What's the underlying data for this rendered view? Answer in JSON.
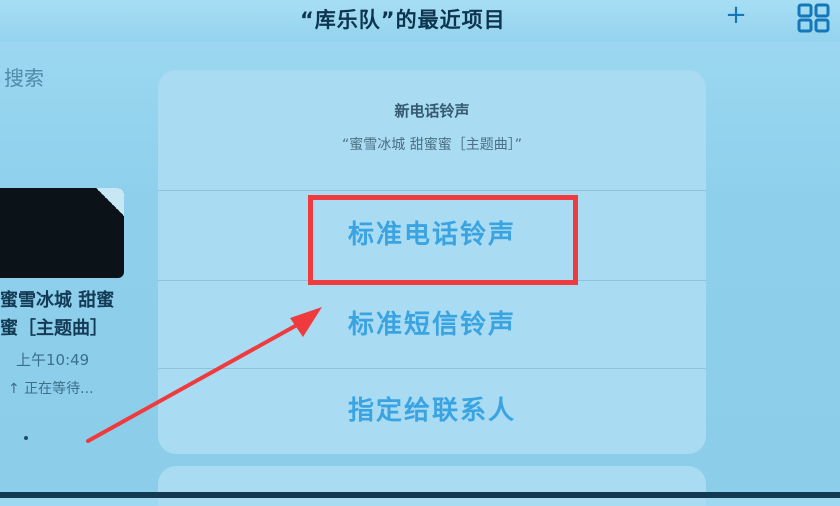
{
  "header": {
    "title": "“库乐队”的最近项目",
    "add_icon": "+",
    "grid_icon": "grid-view"
  },
  "search": {
    "label": "搜索"
  },
  "recent_item": {
    "name_line1": "蜜雪冰城 甜蜜",
    "name_line2": "蜜［主题曲］",
    "time": "上午10:49",
    "status": "↑ 正在等待..."
  },
  "action_sheet": {
    "title": "新电话铃声",
    "subtitle": "“蜜雪冰城 甜蜜蜜［主题曲］”",
    "options": [
      {
        "label": "标准电话铃声"
      },
      {
        "label": "标准短信铃声"
      },
      {
        "label": "指定给联系人"
      }
    ]
  },
  "annotation": {
    "highlight_color": "#ef3b3d"
  }
}
